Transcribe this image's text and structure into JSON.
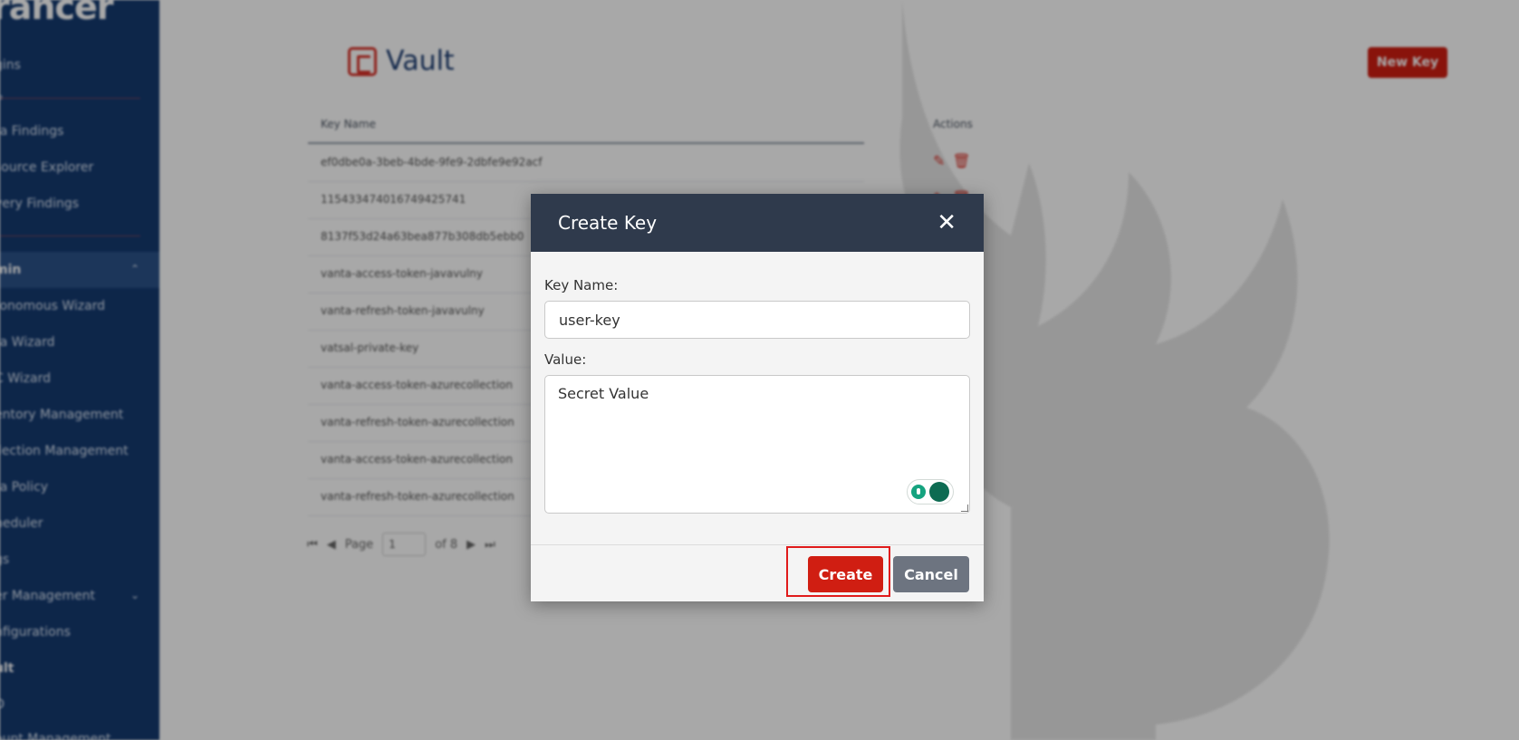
{
  "sidebar": {
    "brand": "rancer",
    "items": [
      {
        "label": "gins"
      },
      {
        "label": "re"
      },
      {
        "label": "ra Findings"
      },
      {
        "label": "source Explorer"
      },
      {
        "label": "very Findings"
      },
      {
        "label": "min"
      },
      {
        "label": "tonomous Wizard"
      },
      {
        "label": "ra Wizard"
      },
      {
        "label": "C Wizard"
      },
      {
        "label": "entory Management"
      },
      {
        "label": "llection Management"
      },
      {
        "label": "ra Policy"
      },
      {
        "label": "heduler"
      },
      {
        "label": "gs"
      },
      {
        "label": "er Management"
      },
      {
        "label": "nfigurations"
      },
      {
        "label": "ult"
      },
      {
        "label": "O"
      },
      {
        "label": "ount Management"
      }
    ]
  },
  "page": {
    "title": "Vault",
    "new_key_label": "New Key"
  },
  "table": {
    "columns": [
      "Key Name",
      "Actions"
    ],
    "rows": [
      {
        "name": "ef0dbe0a-3beb-4bde-9fe9-2dbfe9e92acf"
      },
      {
        "name": "115433474016749425741"
      },
      {
        "name": "8137f53d24a63bea877b308db5ebb0"
      },
      {
        "name": "vanta-access-token-javavulny"
      },
      {
        "name": "vanta-refresh-token-javavulny"
      },
      {
        "name": "vatsal-private-key"
      },
      {
        "name": "vanta-access-token-azurecollection"
      },
      {
        "name": "vanta-refresh-token-azurecollection"
      },
      {
        "name": "vanta-access-token-azurecollection"
      },
      {
        "name": "vanta-refresh-token-azurecollection"
      }
    ]
  },
  "pager": {
    "page_label": "Page",
    "page_value": "1",
    "of_label": "of 8"
  },
  "modal": {
    "title": "Create Key",
    "key_name_label": "Key Name:",
    "key_name_value": "user-key",
    "value_label": "Value:",
    "value_text": "Secret Value",
    "create_label": "Create",
    "cancel_label": "Cancel"
  },
  "colors": {
    "sidebar": "#143a70",
    "modal_header": "#2f3a4c",
    "accent_red": "#d01e12",
    "cancel_gray": "#6d7480"
  }
}
